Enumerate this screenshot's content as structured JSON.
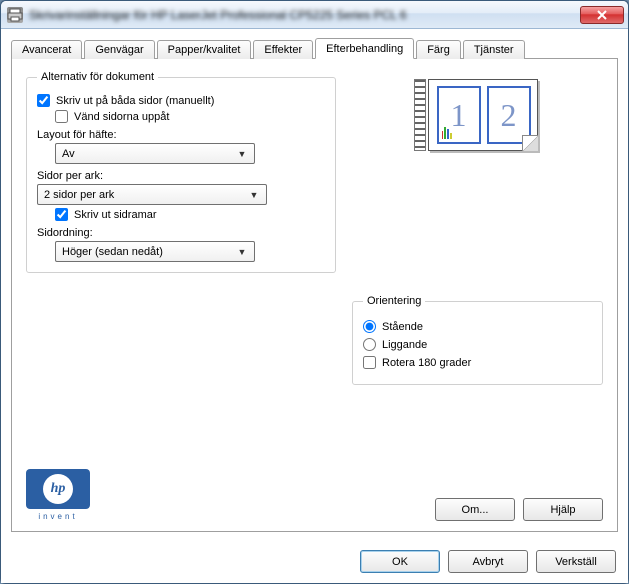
{
  "window": {
    "title": "Skrivarinställningar för HP LaserJet Professional CP5225 Series PCL 6"
  },
  "tabs": {
    "items": [
      {
        "label": "Avancerat"
      },
      {
        "label": "Genvägar"
      },
      {
        "label": "Papper/kvalitet"
      },
      {
        "label": "Effekter"
      },
      {
        "label": "Efterbehandling"
      },
      {
        "label": "Färg"
      },
      {
        "label": "Tjänster"
      }
    ],
    "active_index": 4
  },
  "doc_options": {
    "legend": "Alternativ för dokument",
    "print_both_sides": {
      "label": "Skriv ut på båda sidor (manuellt)",
      "checked": true
    },
    "flip_pages_up": {
      "label": "Vänd sidorna uppåt",
      "checked": false
    },
    "booklet_layout_label": "Layout för häfte:",
    "booklet_layout_value": "Av",
    "pages_per_sheet_label": "Sidor per ark:",
    "pages_per_sheet_value": "2 sidor per ark",
    "print_page_borders": {
      "label": "Skriv ut sidramar",
      "checked": true
    },
    "page_order_label": "Sidordning:",
    "page_order_value": "Höger (sedan nedåt)"
  },
  "orientation": {
    "legend": "Orientering",
    "portrait": {
      "label": "Stående",
      "selected": true
    },
    "landscape": {
      "label": "Liggande",
      "selected": false
    },
    "rotate180": {
      "label": "Rotera 180 grader",
      "checked": false
    }
  },
  "preview": {
    "page1": "1",
    "page2": "2"
  },
  "logo": {
    "brand": "hp",
    "tagline": "invent"
  },
  "buttons": {
    "about": "Om...",
    "help": "Hjälp",
    "ok": "OK",
    "cancel": "Avbryt",
    "apply": "Verkställ"
  }
}
